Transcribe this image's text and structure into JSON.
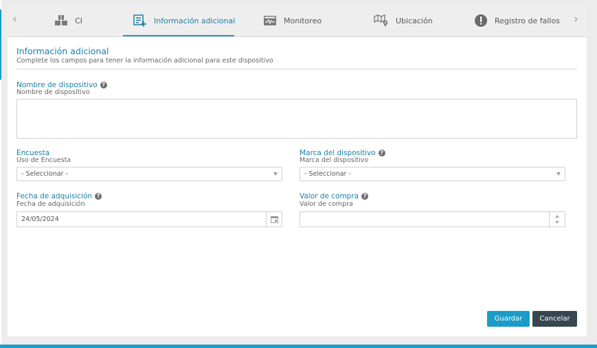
{
  "tabs": [
    {
      "label": "CI",
      "icon": "boxes-icon"
    },
    {
      "label": "Información adicional",
      "icon": "add-list-icon",
      "active": true
    },
    {
      "label": "Monitoreo",
      "icon": "monitor-icon"
    },
    {
      "label": "Ubicación",
      "icon": "map-pin-icon"
    },
    {
      "label": "Registro de fallos",
      "icon": "alert-icon"
    }
  ],
  "section": {
    "title": "Información adicional",
    "subtitle": "Complete los campos para tener la información adicional para este dispositivo"
  },
  "fields": {
    "device_name": {
      "label": "Nombre de dispositivo",
      "sublabel": "Nombre de dispositivo",
      "value": ""
    },
    "survey": {
      "label": "Encuesta",
      "sublabel": "Uso de Encuesta",
      "value": "- Seleccionar -"
    },
    "brand": {
      "label": "Marca del dispositivo",
      "sublabel": "Marca del dispositivo",
      "value": "- Seleccionar -"
    },
    "purchase_date": {
      "label": "Fecha de adquisición",
      "sublabel": "Fecha de adquisición",
      "value": "24/05/2024"
    },
    "purchase_value": {
      "label": "Valor de compra",
      "sublabel": "Valor de compra",
      "value": ""
    }
  },
  "buttons": {
    "save": "Guardar",
    "cancel": "Cancelar"
  },
  "colors": {
    "accent": "#1a9bc8",
    "dark": "#37474f"
  }
}
